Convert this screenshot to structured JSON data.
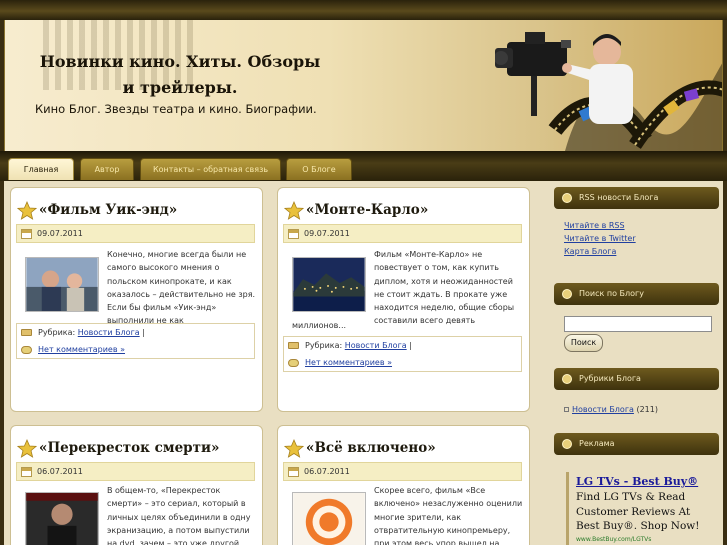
{
  "header": {
    "title": "Новинки кино. Хиты. Обзоры и трейлеры.",
    "description": "Кино Блог. Звезды театра и кино. Биографии."
  },
  "nav": {
    "tabs": [
      {
        "label": "Главная",
        "active": true
      },
      {
        "label": "Автор"
      },
      {
        "label": "Контакты – обратная связь"
      },
      {
        "label": "О Блоге"
      }
    ]
  },
  "posts": [
    {
      "title": "«Фильм Уик-энд»",
      "date": "09.07.2011",
      "excerpt": "Конечно, многие всегда были не самого высокого мнения о польском кинопрокате, и как оказалось – действительно не зря. Если бы фильм «Уик-энд» выполнили не как полнометражную...",
      "excerpt_tail": "",
      "category_label": "Рубрика:",
      "category": "Новости Блога",
      "comments": "Нет комментариев »"
    },
    {
      "title": "«Монте-Карло»",
      "date": "09.07.2011",
      "excerpt": "Фильм «Монте-Карло» не повествует о том, как купить диплом, хотя и неожиданностей не стоит ждать. В прокате уже находится неделю, общие сборы составили всего девять",
      "excerpt_tail": "миллионов...",
      "category_label": "Рубрика:",
      "category": "Новости Блога",
      "comments": "Нет комментариев »"
    },
    {
      "title": "«Перекресток смерти»",
      "date": "06.07.2011",
      "excerpt": "В общем-то, «Перекресток смерти» – это сериал, который в личных целях объединили в одну экранизацию, а потом выпустили на dvd, зачем – это уже другой вопрос."
    },
    {
      "title": "«Всё включено»",
      "date": "06.07.2011",
      "excerpt": "Скорее всего, фильм «Все включено» незаслуженно оценили многие зрители, как отвратительную кинопремьеру, при этом весь упор вышел на"
    }
  ],
  "sidebar": {
    "rss": {
      "title": "RSS новости Блога",
      "links": [
        "Читайте в RSS",
        "Читайте в Twitter",
        "Карта Блога"
      ]
    },
    "search": {
      "title": "Поиск по Блогу",
      "button": "Поиск",
      "value": ""
    },
    "categories": {
      "title": "Рубрики Блога",
      "item": "Новости Блога",
      "count": "(211)"
    },
    "ads": {
      "title": "Реклама",
      "ad_title": "LG TVs - Best Buy®",
      "ad_text": "Find LG TVs & Read Customer Reviews At Best Buy®. Shop Now!",
      "ad_url": "www.BestBuy.com/LGTVs"
    }
  },
  "colors": {
    "accent": "#6e5a1e",
    "link": "#2140a0",
    "date_bar": "#f5eec4"
  }
}
